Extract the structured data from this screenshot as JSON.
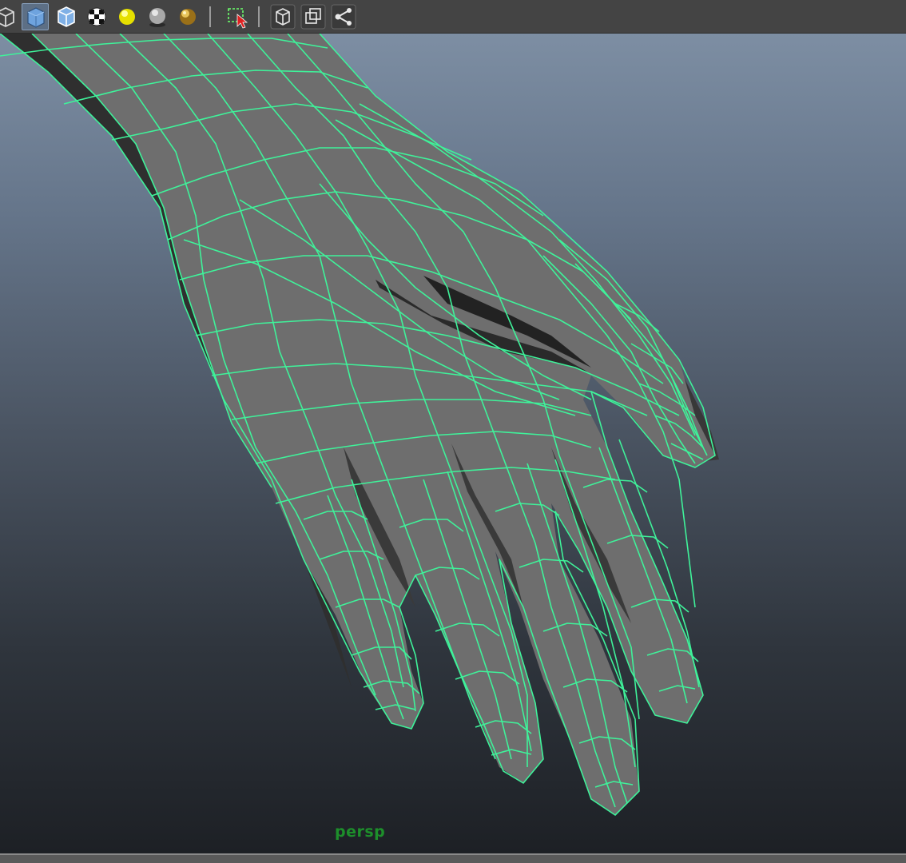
{
  "toolbar": {
    "buttons": [
      {
        "name": "wireframe-shading-icon",
        "active": false
      },
      {
        "name": "smooth-shade-icon",
        "active": true
      },
      {
        "name": "wireframe-on-shaded-icon",
        "active": false
      },
      {
        "name": "textured-icon",
        "active": false
      },
      {
        "name": "use-all-lights-icon",
        "active": false
      },
      {
        "name": "shadows-icon",
        "active": false
      },
      {
        "name": "high-quality-render-icon",
        "active": false
      },
      {
        "name": "isolate-select-icon",
        "active": false
      },
      {
        "name": "xray-icon",
        "active": false
      },
      {
        "name": "xray-active-components-icon",
        "active": false
      },
      {
        "name": "xray-joints-icon",
        "active": false
      }
    ]
  },
  "viewport": {
    "camera_label": "persp",
    "wire_color": "#3ff29a",
    "mesh_color": "#6e6e6e",
    "mesh_dark_color": "#323232"
  }
}
